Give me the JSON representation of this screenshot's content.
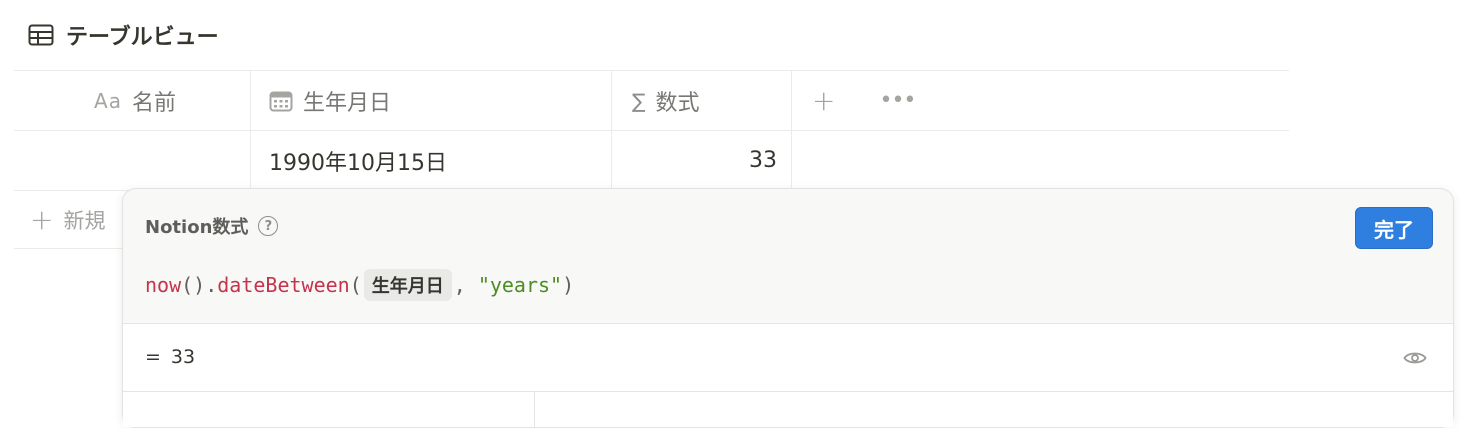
{
  "view": {
    "title": "テーブルビュー"
  },
  "table": {
    "columns": [
      {
        "icon": "Aa",
        "label": "名前"
      },
      {
        "icon": "calendar-icon",
        "label": "生年月日"
      },
      {
        "icon": "∑",
        "label": "数式"
      }
    ],
    "add_column": "+",
    "more": "•••",
    "rows": [
      {
        "name": "",
        "birthday": "1990年10月15日",
        "formula": "33"
      }
    ],
    "new_row": {
      "icon": "+",
      "label": "新規"
    }
  },
  "formula_editor": {
    "title": "Notion数式",
    "help": "?",
    "done_label": "完了",
    "expression": {
      "fn_now": "now",
      "paren_open_close": "()",
      "dot": ".",
      "fn_between": "dateBetween",
      "paren_open": "(",
      "property": "生年月日",
      "comma": ",",
      "string": "\"years\"",
      "paren_close": ")"
    },
    "result": {
      "prefix": "=",
      "value": "33"
    }
  },
  "colors": {
    "accent": "#2f7fe0",
    "function": "#c4344d",
    "string": "#4d8c22"
  }
}
